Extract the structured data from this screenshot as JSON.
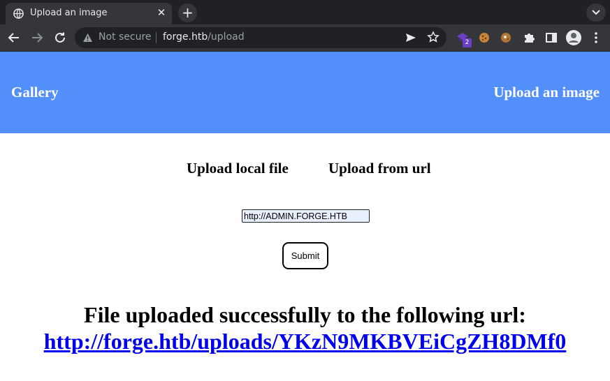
{
  "browser": {
    "tab_title": "Upload an image",
    "tab_close": "✕",
    "new_tab": "+",
    "security_label": "Not secure",
    "url_host": "forge.htb",
    "url_path": "/upload",
    "extension_badge": "2"
  },
  "header": {
    "gallery_label": "Gallery",
    "upload_label": "Upload an image",
    "background_color": "#528ffa"
  },
  "upload_modes": {
    "local": "Upload local file",
    "url": "Upload from url"
  },
  "form": {
    "url_value": "http://ADMIN.FORGE.HTB",
    "submit_label": "Submit"
  },
  "result": {
    "message": "File uploaded successfully to the following url:",
    "link": "http://forge.htb/uploads/YKzN9MKBVEiCgZH8DMf0",
    "link_color": "#0000ee"
  }
}
